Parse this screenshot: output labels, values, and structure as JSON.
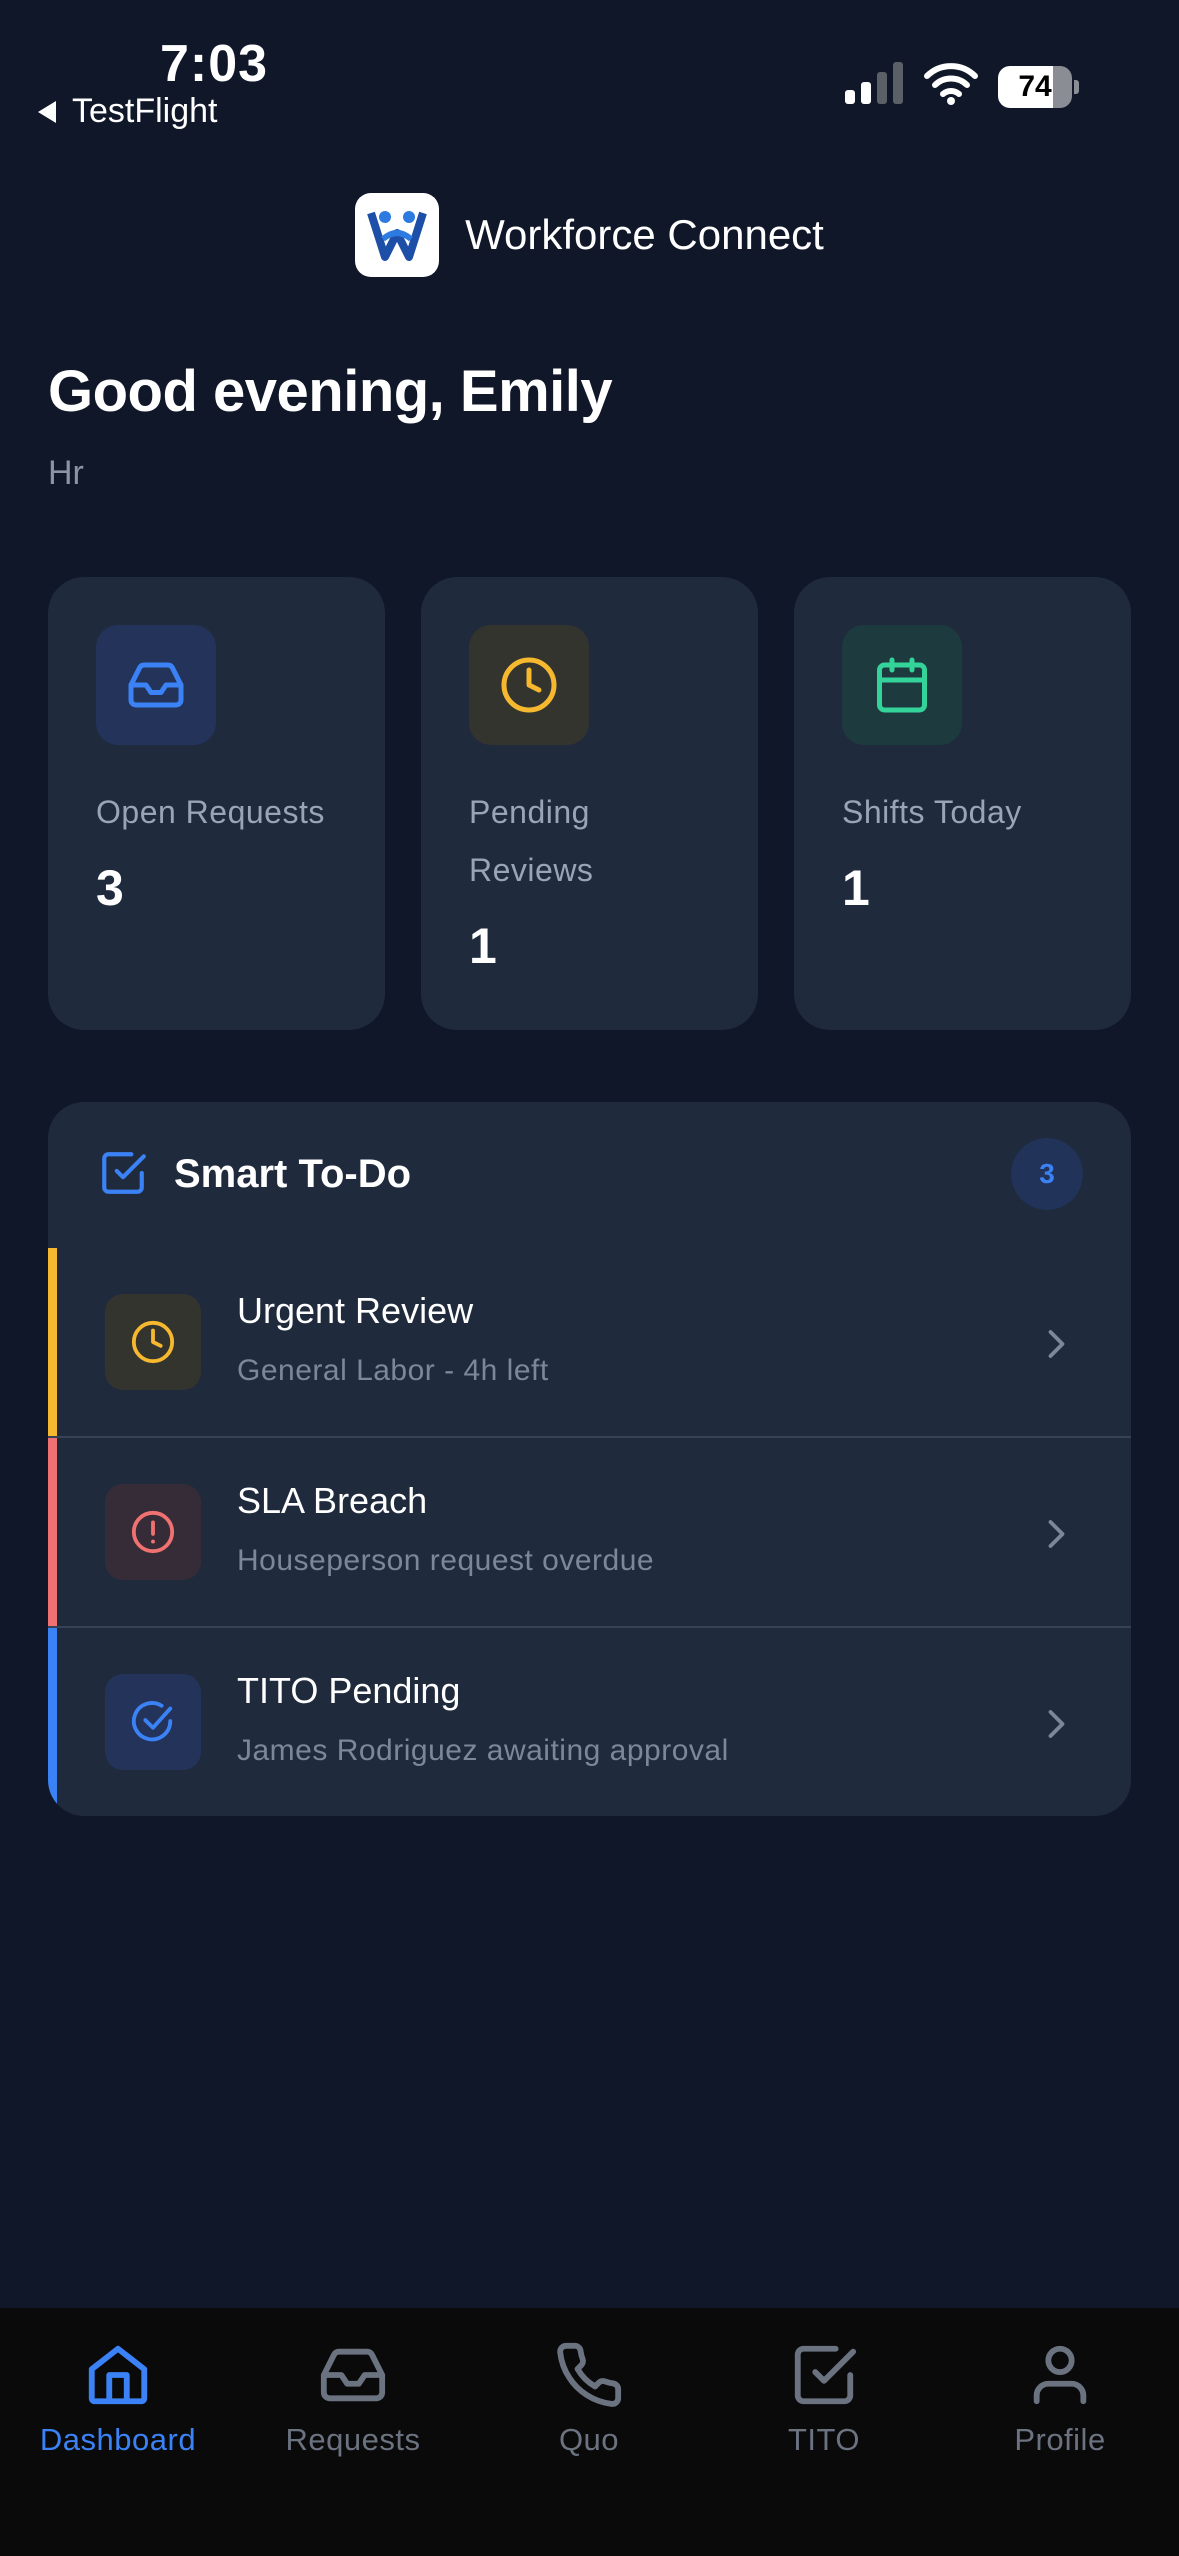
{
  "status_bar": {
    "time": "7:03",
    "back_label": "TestFlight",
    "battery": "74"
  },
  "header": {
    "app_title": "Workforce Connect"
  },
  "greeting": "Good evening, Emily",
  "role": "Hr",
  "stats": [
    {
      "label": "Open Requests",
      "value": "3",
      "icon": "inbox-icon",
      "color": "#3b82f6"
    },
    {
      "label": "Pending Reviews",
      "value": "1",
      "icon": "clock-icon",
      "color": "#f5b82e"
    },
    {
      "label": "Shifts Today",
      "value": "1",
      "icon": "calendar-icon",
      "color": "#34d399"
    }
  ],
  "todo": {
    "title": "Smart To-Do",
    "count": "3",
    "items": [
      {
        "title": "Urgent Review",
        "subtitle": "General Labor - 4h left",
        "icon": "clock-icon",
        "accent": "#f5b82e"
      },
      {
        "title": "SLA Breach",
        "subtitle": "Houseperson request overdue",
        "icon": "alert-circle-icon",
        "accent": "#f07171"
      },
      {
        "title": "TITO Pending",
        "subtitle": "James Rodriguez awaiting approval",
        "icon": "check-circle-icon",
        "accent": "#3b82f6"
      }
    ]
  },
  "tabs": [
    {
      "label": "Dashboard",
      "icon": "home-icon",
      "active": true
    },
    {
      "label": "Requests",
      "icon": "inbox-icon",
      "active": false
    },
    {
      "label": "Quo",
      "icon": "phone-icon",
      "active": false
    },
    {
      "label": "TITO",
      "icon": "checkbox-icon",
      "active": false
    },
    {
      "label": "Profile",
      "icon": "user-icon",
      "active": false
    }
  ]
}
